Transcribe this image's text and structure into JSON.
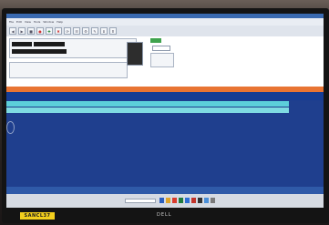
{
  "menu": {
    "items": [
      "File",
      "Edit",
      "View",
      "Tools",
      "Window",
      "Help"
    ]
  },
  "toolbar": {
    "buttons": [
      "◀",
      "▶",
      "■",
      "●",
      "✚",
      "✖",
      "⟳",
      "☰",
      "⚙",
      "✎",
      "⬇",
      "⬆"
    ]
  },
  "panel": {
    "black_fields": [
      "",
      "",
      ""
    ],
    "badge": "",
    "combo_value": ""
  },
  "grid": {
    "header": [
      "",
      "",
      "",
      "",
      "",
      "",
      "",
      "",
      "",
      ""
    ],
    "subheader": [
      "",
      "",
      "",
      "",
      "",
      "",
      "",
      "",
      "",
      ""
    ],
    "rows": [
      [
        "",
        "",
        "",
        "",
        "",
        "",
        "",
        "",
        "",
        ""
      ],
      [
        "",
        "",
        "",
        "",
        "",
        "",
        "",
        "",
        "",
        ""
      ]
    ]
  },
  "status": {
    "left": "",
    "right": ""
  },
  "taskbar": {
    "search_placeholder": "",
    "clock": ""
  },
  "sticker": {
    "text": "SANCL37"
  },
  "brand": {
    "text": "DELL"
  },
  "colors": {
    "screen_bg": "#1f3f8e",
    "grid_header": "#e87433",
    "grid_row": "#5ccfda",
    "sticker": "#f3cf1d"
  }
}
